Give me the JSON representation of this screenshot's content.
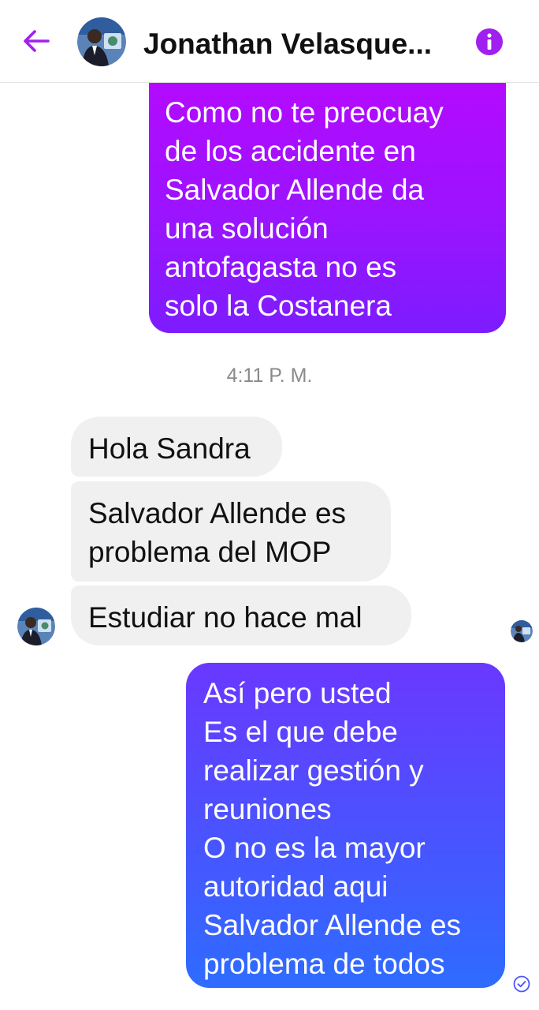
{
  "header": {
    "back_icon": "arrow-left-icon",
    "contact_name": "Jonathan Velasque...",
    "info_icon": "info-icon",
    "accent_color": "#a020f0"
  },
  "messages": {
    "outgoing_1": "Como no te preocuay\nde los accidente en\nSalvador Allende  da\nuna solución\nantofagasta no es\nsolo la Costanera",
    "timestamp": "4:11 P. M.",
    "incoming_1": "Hola Sandra",
    "incoming_2": "Salvador Allende es\nproblema del MOP",
    "incoming_3": "Estudiar no hace mal",
    "outgoing_2": "Así pero usted\nEs el que debe\nrealizar gestión y\nreuniones\nO no es la mayor\nautoridad aqui\nSalvador Allende es\nproblema de todos"
  },
  "colors": {
    "outgoing_purple": "#9a14ff",
    "outgoing_blue": "#3f5cff",
    "incoming_gray": "#f0f0f0"
  },
  "status": {
    "sent_icon": "check-circle-icon",
    "seen_avatar_icon": "avatar-icon"
  }
}
